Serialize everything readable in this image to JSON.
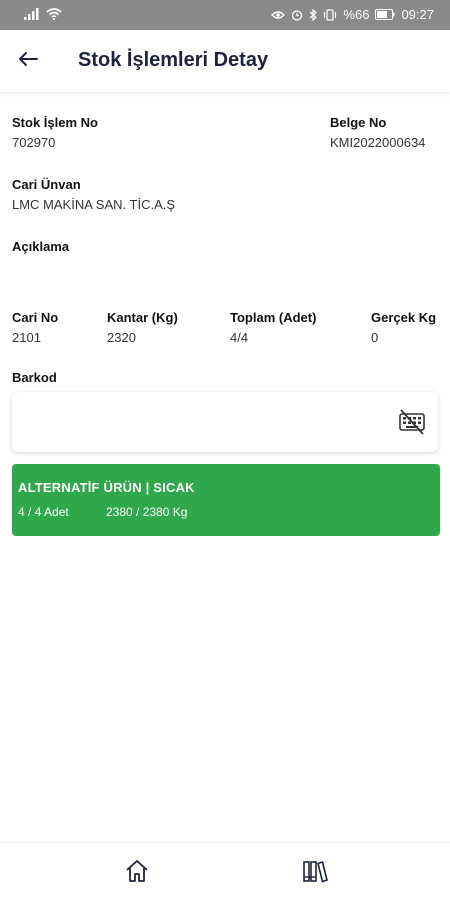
{
  "status_bar": {
    "battery_percent": "%66",
    "time": "09:27",
    "left_icons": [
      "signal-icon",
      "wifi-icon"
    ],
    "right_icons": [
      "eye-icon",
      "alarm-icon",
      "bluetooth-icon",
      "vibrate-icon",
      "battery-icon"
    ]
  },
  "app_bar": {
    "title": "Stok İşlemleri Detay",
    "back_icon": "back-arrow-icon"
  },
  "detail": {
    "stok_islem_no": {
      "label": "Stok İşlem No",
      "value": "702970"
    },
    "belge_no": {
      "label": "Belge No",
      "value": "KMI2022000634"
    },
    "cari_unvan": {
      "label": "Cari Ünvan",
      "value": "LMC MAKİNA SAN. TİC.A.Ş"
    },
    "aciklama": {
      "label": "Açıklama",
      "value": ""
    },
    "cari_no": {
      "label": "Cari No",
      "value": "2101"
    },
    "kantar": {
      "label": "Kantar (Kg)",
      "value": "2320"
    },
    "toplam": {
      "label": "Toplam (Adet)",
      "value": "4/4"
    },
    "gercek_kg": {
      "label": "Gerçek Kg",
      "value": "0"
    }
  },
  "barkod": {
    "label": "Barkod",
    "value": "",
    "placeholder": "",
    "keyboard_icon": "keyboard-off-icon"
  },
  "result_card": {
    "title": "ALTERNATİF ÜRÜN | SICAK",
    "quantity": "4 / 4 Adet",
    "weight": "2380 / 2380 Kg",
    "color": "#2ea84a"
  },
  "bottom_nav": {
    "items": [
      {
        "icon": "home-icon"
      },
      {
        "icon": "library-icon"
      }
    ]
  }
}
